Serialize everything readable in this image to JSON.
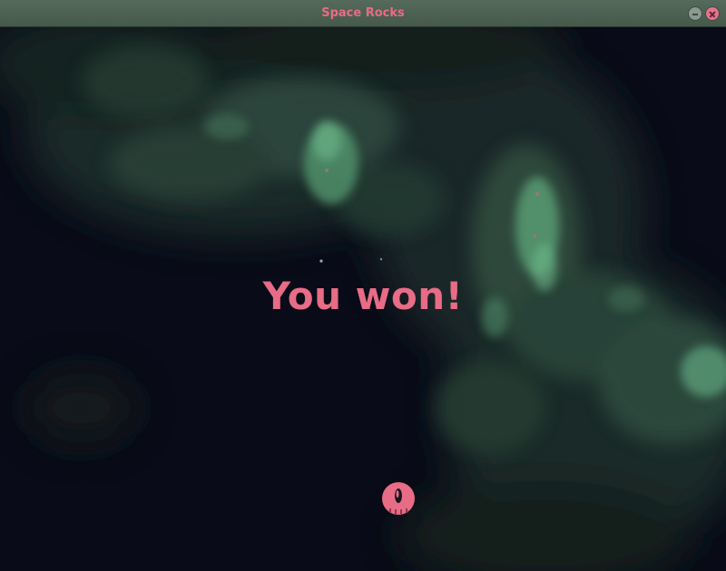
{
  "window": {
    "title": "Space Rocks",
    "buttons": [
      "minimize",
      "close"
    ]
  },
  "game": {
    "message": "You won!",
    "background": "green nebula starfield",
    "player": "spaceship-icon"
  },
  "colors": {
    "accent": "#e86c86",
    "titlebar": "#4d6152",
    "space": "#090c18",
    "nebula": "#5a9c78"
  }
}
